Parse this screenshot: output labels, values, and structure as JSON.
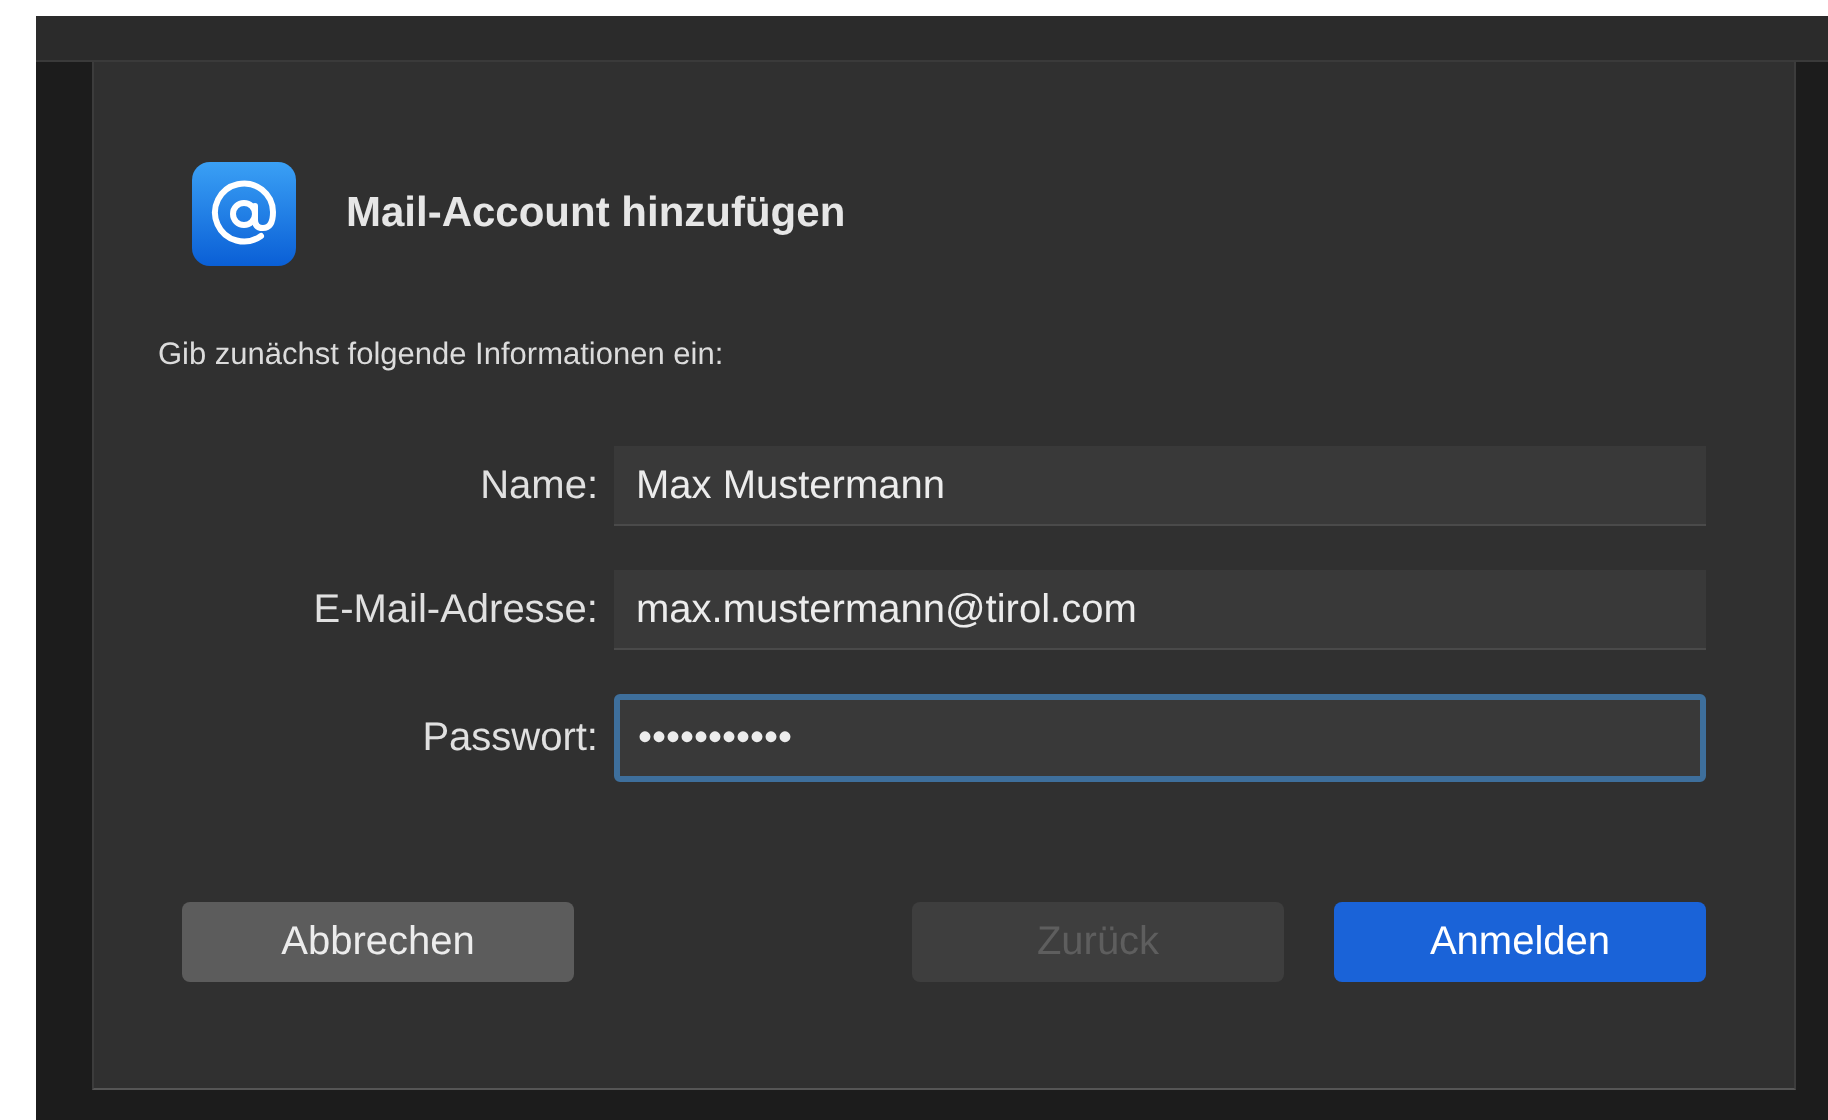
{
  "dialog": {
    "title": "Mail-Account hinzufügen",
    "instruction": "Gib zunächst folgende Informationen ein:"
  },
  "fields": [
    {
      "label": "Name:",
      "value": "Max Mustermann",
      "focused": false
    },
    {
      "label": "E-Mail-Adresse:",
      "value": "max.mustermann@tirol.com",
      "focused": false
    },
    {
      "label": "Passwort:",
      "value": "•••••••••••",
      "focused": true
    }
  ],
  "buttons": [
    {
      "label": "Abbrechen",
      "disabled": false,
      "default": false
    },
    {
      "label": "Zurück",
      "disabled": true,
      "default": false
    },
    {
      "label": "Anmelden",
      "disabled": false,
      "default": true
    }
  ]
}
